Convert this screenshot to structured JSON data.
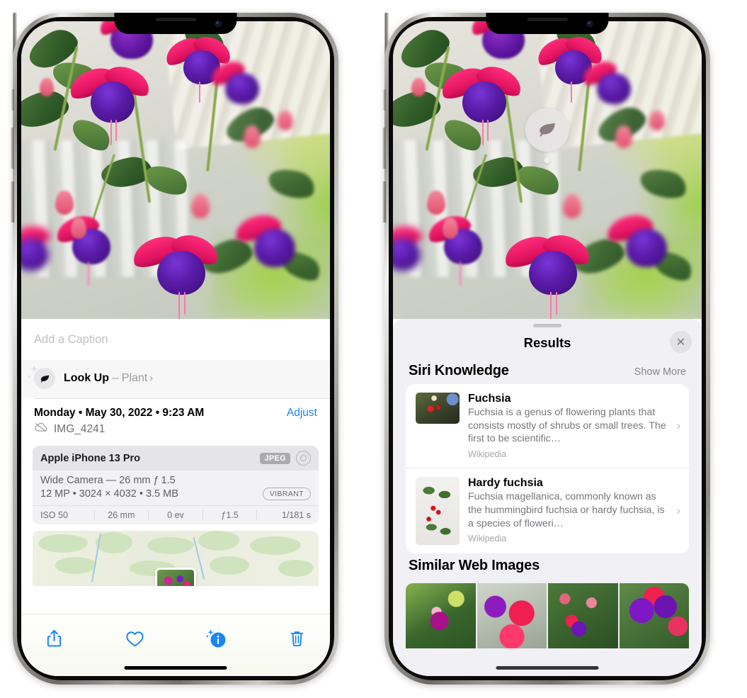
{
  "left_phone": {
    "photo": {
      "alt_name": "fuchsia-flowers-photo"
    },
    "caption": {
      "placeholder": "Add a Caption",
      "value": ""
    },
    "look_up": {
      "icon": "leaf-icon",
      "label": "Look Up",
      "dash": " – ",
      "subject": "Plant",
      "chevron": "›"
    },
    "metadata": {
      "date": "Monday • May 30, 2022 • 9:23 AM",
      "adjust_label": "Adjust",
      "cloud_icon": "icloud-slash-icon",
      "filename": "IMG_4241"
    },
    "exif": {
      "device": "Apple iPhone 13 Pro",
      "format_badge": "JPEG",
      "aperture_icon": "aperture-icon",
      "lens_line": "Wide Camera — 26 mm ƒ 1.5",
      "size_line": "12 MP  •  3024 × 4032  •  3.5 MB",
      "style_badge": "VIBRANT",
      "stats": [
        "ISO 50",
        "26 mm",
        "0 ev",
        "ƒ1.5",
        "1/181 s"
      ]
    },
    "toolbar": {
      "share": "share-icon",
      "favorite": "heart-icon",
      "info": "info-sparkle-icon",
      "delete": "trash-icon"
    }
  },
  "right_phone": {
    "photo": {
      "badge_icon": "leaf-icon"
    },
    "sheet": {
      "title": "Results",
      "close_label": "✕"
    },
    "siri_knowledge": {
      "title": "Siri Knowledge",
      "show_more": "Show More",
      "items": [
        {
          "title": "Fuchsia",
          "description": "Fuchsia is a genus of flowering plants that consists mostly of shrubs or small trees. The first to be scientific…",
          "source": "Wikipedia",
          "chevron": "›"
        },
        {
          "title": "Hardy fuchsia",
          "description": "Fuchsia magellanica, commonly known as the hummingbird fuchsia or hardy fuchsia, is a species of floweri…",
          "source": "Wikipedia",
          "chevron": "›"
        }
      ]
    },
    "similar_web_images": {
      "title": "Similar Web Images",
      "thumbnails": [
        "fuchsia-web-image-1",
        "fuchsia-web-image-2",
        "fuchsia-web-image-3",
        "fuchsia-web-image-4"
      ]
    }
  },
  "colors": {
    "accent_blue": "#1886f8",
    "sheet_bg": "#f1f0f5",
    "card_bg": "#ffffff",
    "secondary_text": "#77777d",
    "badge_gray": "#a9a9ae"
  }
}
